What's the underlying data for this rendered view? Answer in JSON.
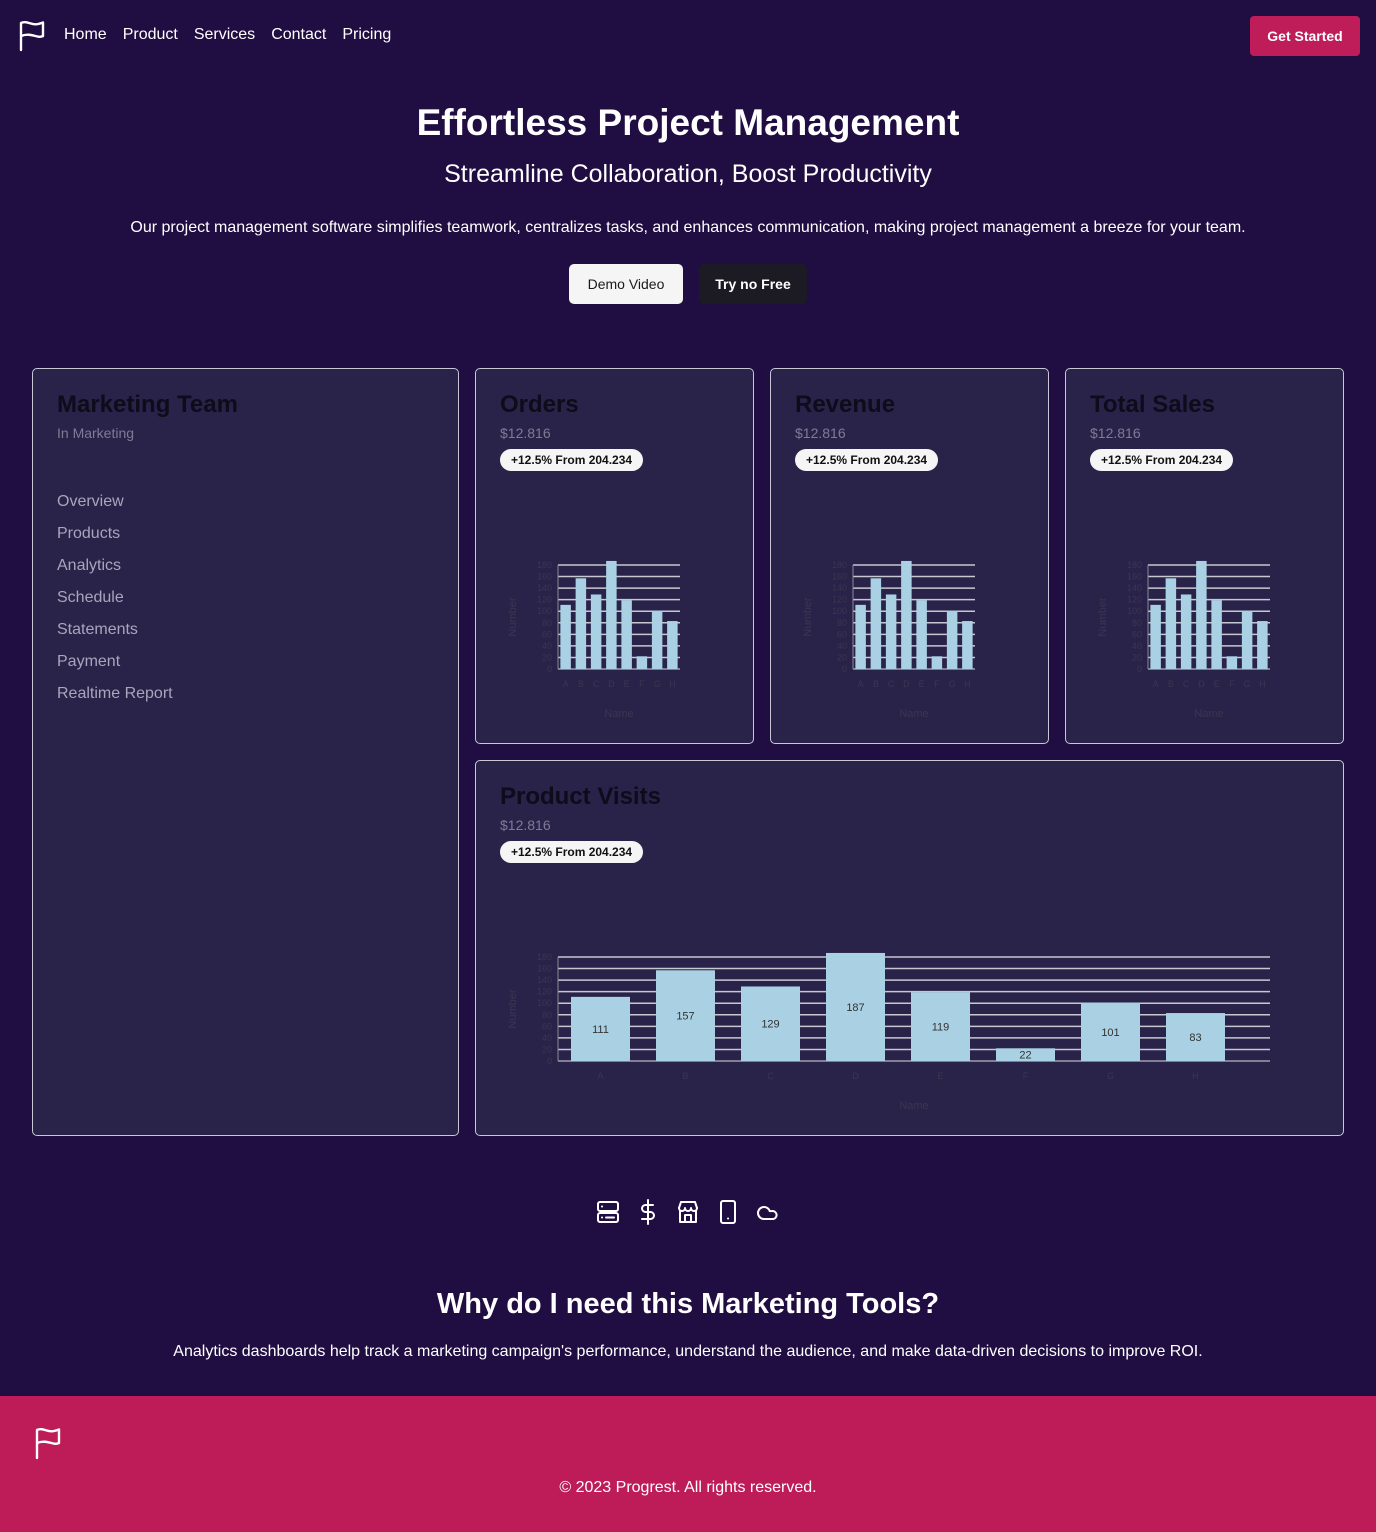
{
  "nav": {
    "logo_icon": "flag-icon",
    "links": [
      "Home",
      "Product",
      "Services",
      "Contact",
      "Pricing"
    ],
    "cta_label": "Get Started"
  },
  "hero": {
    "title": "Effortless Project Management",
    "subtitle": "Streamline Collaboration, Boost Productivity",
    "description": "Our project management software simplifies teamwork, centralizes tasks, and enhances communication, making project management a breeze for your team.",
    "demo_label": "Demo Video",
    "try_label": "Try no Free"
  },
  "team": {
    "title": "Marketing Team",
    "subtitle": "In Marketing",
    "menu": [
      "Overview",
      "Products",
      "Analytics",
      "Schedule",
      "Statements",
      "Payment",
      "Realtime Report"
    ]
  },
  "cards": [
    {
      "title": "Orders",
      "value": "$12.816",
      "badge": "+12.5% From 204.234"
    },
    {
      "title": "Revenue",
      "value": "$12.816",
      "badge": "+12.5% From 204.234"
    },
    {
      "title": "Total Sales",
      "value": "$12.816",
      "badge": "+12.5% From 204.234"
    },
    {
      "title": "Product Visits",
      "value": "$12.816",
      "badge": "+12.5% From 204.234"
    }
  ],
  "chart_data": [
    {
      "type": "bar",
      "categories": [
        "A",
        "B",
        "C",
        "D",
        "E",
        "F",
        "G",
        "H"
      ],
      "values": [
        111,
        157,
        129,
        187,
        119,
        22,
        101,
        83
      ],
      "xlabel": "Name",
      "ylabel": "Number",
      "ylim": [
        0,
        180
      ],
      "grid": true
    },
    {
      "type": "bar",
      "categories": [
        "A",
        "B",
        "C",
        "D",
        "E",
        "F",
        "G",
        "H"
      ],
      "values": [
        111,
        157,
        129,
        187,
        119,
        22,
        101,
        83
      ],
      "xlabel": "Name",
      "ylabel": "Number",
      "ylim": [
        0,
        180
      ],
      "grid": true
    },
    {
      "type": "bar",
      "categories": [
        "A",
        "B",
        "C",
        "D",
        "E",
        "F",
        "G",
        "H"
      ],
      "values": [
        111,
        157,
        129,
        187,
        119,
        22,
        101,
        83
      ],
      "xlabel": "Name",
      "ylabel": "Number",
      "ylim": [
        0,
        180
      ],
      "grid": true
    },
    {
      "type": "bar",
      "categories": [
        "A",
        "B",
        "C",
        "D",
        "E",
        "F",
        "G",
        "H"
      ],
      "values": [
        111,
        157,
        129,
        187,
        119,
        22,
        101,
        83
      ],
      "xlabel": "Name",
      "ylabel": "Number",
      "ylim": [
        0,
        180
      ],
      "grid": true
    }
  ],
  "icons": [
    "server-icon",
    "dollar-icon",
    "store-icon",
    "tablet-icon",
    "cloud-icon"
  ],
  "why": {
    "title": "Why do I need this Marketing Tools?",
    "description": "Analytics dashboards help track a marketing campaign's performance, understand the audience, and make data-driven decisions to improve ROI."
  },
  "footer": {
    "logo_icon": "flag-icon",
    "copyright": "© 2023 Progrest. All rights reserved."
  },
  "colors": {
    "background": "#200d42",
    "card": "#29234a",
    "accent": "#bf1d5a",
    "bar": "#a9d0e3"
  }
}
